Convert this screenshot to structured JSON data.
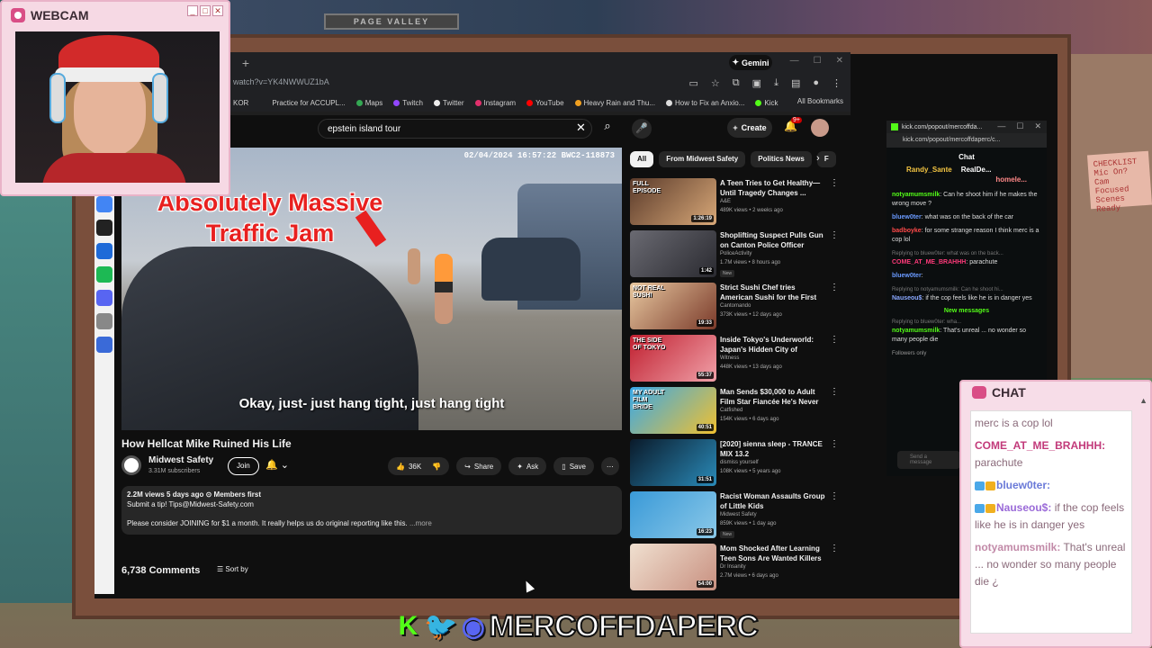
{
  "webcam": {
    "title": "WEBCAM"
  },
  "room": {
    "sign": "PAGE VALLEY",
    "note": "CHECKLIST Mic On? Cam Focused Scenes Ready"
  },
  "browser": {
    "gemini": "Gemini",
    "url": "watch?v=YK4NWWUZ1bA",
    "bookmarks": [
      "KOR",
      "Practice for ACCUPL...",
      "Maps",
      "Twitch",
      "Twitter",
      "Instagram",
      "YouTube",
      "Heavy Rain and Thu...",
      "How to Fix an Anxio...",
      "Kick"
    ],
    "all_bookmarks": "All Bookmarks"
  },
  "youtube": {
    "search_value": "epstein island tour",
    "create_label": "Create",
    "notif_count": "9+",
    "player": {
      "headline_1": "Absolutely Massive",
      "headline_2": "Traffic Jam",
      "timestamp": "02/04/2024 16:57:22 BWC2-118873",
      "caption": "Okay, just- just hang tight, just hang tight"
    },
    "video_title": "How Hellcat Mike Ruined His Life",
    "channel": {
      "name": "Midwest Safety",
      "subs": "3.31M subscribers",
      "join": "Join"
    },
    "actions": {
      "likes": "36K",
      "share": "Share",
      "ask": "Ask",
      "save": "Save"
    },
    "desc": {
      "meta": "2.2M views  5 days ago  ⊙ Members first",
      "line1": "Submit a tip! Tips@Midwest-Safety.com",
      "line2": "Please consider JOINING for $1 a month. It really helps us do original reporting like this.",
      "more": "...more"
    },
    "comments": "6,738 Comments",
    "sort_by": "Sort by",
    "chips": [
      "All",
      "From Midwest Safety",
      "Politics News",
      "F"
    ],
    "sidebar": [
      {
        "title": "A Teen Tries to Get Healthy—Until Tragedy Changes ...",
        "channel": "A&E",
        "meta": "489K views • 2 weeks ago",
        "dur": "1:26:19",
        "badge": "",
        "thumb_text": "FULL EPISODE",
        "c1": "#5a3a2a",
        "c2": "#d8a878"
      },
      {
        "title": "Shoplifting Suspect Pulls Gun on Canton Police Officer Insid...",
        "channel": "PoliceActivity",
        "meta": "1.7M views • 8 hours ago",
        "dur": "1:42",
        "badge": "New",
        "thumb_text": "",
        "c1": "#6a6a72",
        "c2": "#2a2a30"
      },
      {
        "title": "Strict Sushi Chef tries American Sushi for the First Time",
        "channel": "Cantomando",
        "meta": "373K views • 12 days ago",
        "dur": "19:33",
        "badge": "",
        "thumb_text": "NOT REAL SUSHI",
        "c1": "#e8c8a0",
        "c2": "#7a3a2a"
      },
      {
        "title": "Inside Tokyo's Underworld: Japan's Hidden City of Women...",
        "channel": "Witness",
        "meta": "448K views • 13 days ago",
        "dur": "55:37",
        "badge": "",
        "thumb_text": "THE SIDE OF TOKYO",
        "c1": "#c02030",
        "c2": "#f0a0a8"
      },
      {
        "title": "Man Sends $30,000 to Adult Film Star Fiancée He's Never ...",
        "channel": "Catfished",
        "meta": "154K views • 6 days ago",
        "dur": "40:51",
        "badge": "",
        "thumb_text": "MY ADULT FILM BRIDE",
        "c1": "#38a8e8",
        "c2": "#f0c030"
      },
      {
        "title": "[2020] sienna sleep - TRANCE MIX 13.2",
        "channel": "dismiss yourself",
        "meta": "108K views • 5 years ago",
        "dur": "31:51",
        "badge": "",
        "thumb_text": "",
        "c1": "#0a1a2a",
        "c2": "#2a8ab8"
      },
      {
        "title": "Racist Woman Assaults Group of Little Kids",
        "channel": "Midwest Safety",
        "meta": "859K views • 1 day ago",
        "dur": "16:23",
        "badge": "New",
        "thumb_text": "",
        "c1": "#3a9ad8",
        "c2": "#8ac8e8"
      },
      {
        "title": "Mom Shocked After Learning Teen Sons Are Wanted Killers",
        "channel": "Dr Insanity",
        "meta": "2.7M views • 6 days ago",
        "dur": "54:00",
        "badge": "",
        "thumb_text": "",
        "c1": "#f0e0d0",
        "c2": "#c89080"
      }
    ]
  },
  "kick": {
    "title": "kick.com/popout/mercoffda...",
    "url": "kick.com/popout/mercoffdaperc/c...",
    "chat_header": "Chat",
    "leaders": [
      "Randy_Sante",
      "RealDe...",
      "homele..."
    ],
    "messages": [
      {
        "user": "notyamumsmilk",
        "text": ": Can he shoot him if he makes the wrong move ?",
        "color": "#53fc18",
        "reply": ""
      },
      {
        "user": "bluew0ter",
        "text": ": what was on the back of the car",
        "color": "#6a9aff",
        "reply": ""
      },
      {
        "user": "badboyke",
        "text": ": for some strange reason I think merc is a cop lol",
        "color": "#ff4a4a",
        "reply": ""
      },
      {
        "user": "COME_AT_ME_BRAHHH",
        "text": ": parachute",
        "color": "#ff3a7a",
        "reply": "Replying to bluew0ter: what was on the back..."
      },
      {
        "user": "bluew0ter",
        "text": ":",
        "color": "#6a9aff",
        "reply": ""
      },
      {
        "user": "Nauseou$",
        "text": ": if the cop feels like he is in danger yes",
        "color": "#8aa8ff",
        "reply": "Replying to notyamumsmilk: Can he shoot hi..."
      }
    ],
    "new_messages": "New messages",
    "last": {
      "user": "notyamumsmilk",
      "text": ": That's unreal ... no wonder so many people die",
      "reply": "Replying to bluew0ter: wha..."
    },
    "followers_only": "Followers only",
    "input_placeholder": "Send a message"
  },
  "chat": {
    "title": "CHAT",
    "messages": [
      {
        "user": "",
        "text": "merc is a cop lol",
        "cls": "u4"
      },
      {
        "user": "COME_AT_ME_BRAHHH:",
        "text": " parachute",
        "cls": "u1"
      },
      {
        "user": "bluew0ter:",
        "text": "",
        "cls": "u2"
      },
      {
        "user": "Nauseou$:",
        "text": " if the cop feels like he is in danger yes",
        "cls": "u3"
      },
      {
        "user": "notyamumsmilk:",
        "text": " That's unreal ... no wonder so many people die ¿",
        "cls": "u4"
      }
    ]
  },
  "banner": {
    "name": "MERCOFFDAPERC"
  }
}
